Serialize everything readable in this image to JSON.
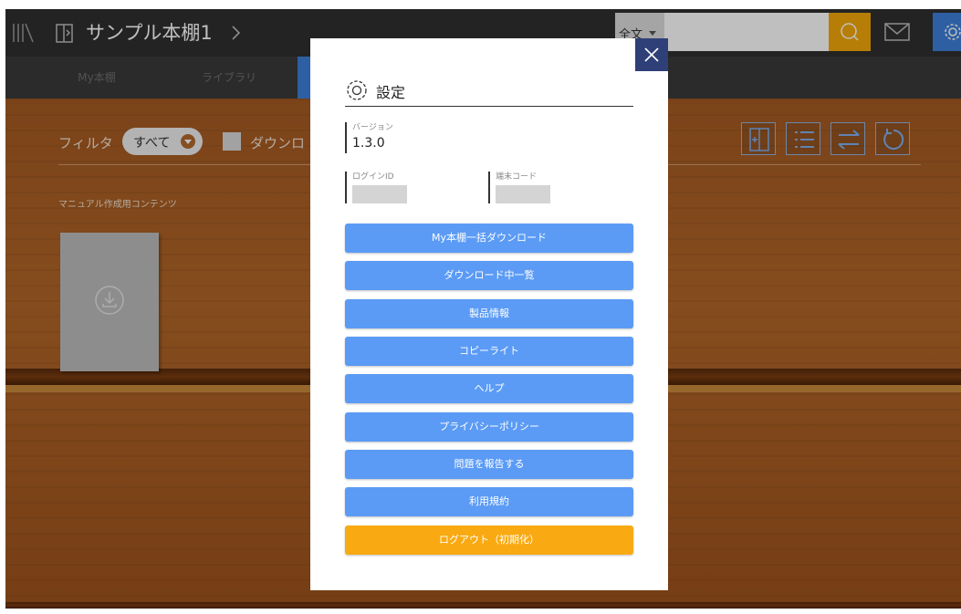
{
  "topbar": {
    "shelf_title": "サンプル本棚1",
    "search_scope": "全文",
    "search_placeholder": ""
  },
  "nav": {
    "tabs": [
      {
        "label": "My本棚"
      },
      {
        "label": "ライブラリ"
      }
    ]
  },
  "filter": {
    "label": "フィルタ",
    "selected": "すべて",
    "download_label": "ダウンロ"
  },
  "content": {
    "name": "マニュアル作成用コンテンツ"
  },
  "settings": {
    "title": "設定",
    "version_label": "バージョン",
    "version_value": "1.3.0",
    "login_id_label": "ログインID",
    "terminal_code_label": "端末コード",
    "buttons": [
      {
        "label": "My本棚一括ダウンロード"
      },
      {
        "label": "ダウンロード中一覧"
      },
      {
        "label": "製品情報"
      },
      {
        "label": "コピーライト"
      },
      {
        "label": "ヘルプ"
      },
      {
        "label": "プライバシーポリシー"
      },
      {
        "label": "問題を報告する"
      },
      {
        "label": "利用規約"
      }
    ],
    "logout_label": "ログアウト（初期化）"
  },
  "colors": {
    "accent_blue": "#3e7fd9",
    "button_blue": "#5b9bf5",
    "logout_orange": "#f9aa12",
    "search_orange": "#f5a80a",
    "close_navy": "#2f4078"
  },
  "icons": {
    "topbar": [
      "library-icon",
      "book-icon",
      "chevron-right-icon",
      "search-icon",
      "mail-icon",
      "gear-icon"
    ],
    "toolbar": [
      "add-book-icon",
      "list-view-icon",
      "sort-icon",
      "refresh-icon"
    ],
    "modal": [
      "close-icon",
      "gear-icon"
    ]
  }
}
